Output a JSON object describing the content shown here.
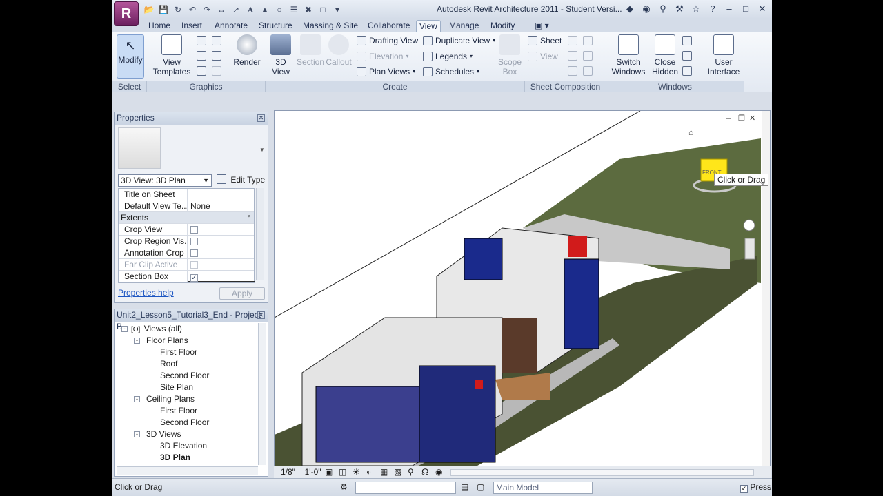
{
  "app": {
    "title": "Autodesk Revit Architecture 2011 - Student Versi...",
    "logo_letter": "R",
    "colors": {
      "app_purple": "#8e2f7c",
      "ribbon_bg": "#eef2f8",
      "grass": "#5c6b3f",
      "window_blue": "#1a2a8c",
      "accent_red": "#d11b1b"
    }
  },
  "tabs": [
    {
      "label": "Home"
    },
    {
      "label": "Insert"
    },
    {
      "label": "Annotate"
    },
    {
      "label": "Structure"
    },
    {
      "label": "Massing & Site"
    },
    {
      "label": "Collaborate"
    },
    {
      "label": "View"
    },
    {
      "label": "Manage"
    },
    {
      "label": "Modify"
    }
  ],
  "active_tab": "View",
  "ribbon": {
    "modify": "Modify",
    "view_templates": "View Templates",
    "render": "Render",
    "view_3d": "3D View",
    "section": "Section",
    "callout": "Callout",
    "drafting_view": "Drafting View",
    "elevation": "Elevation",
    "plan_views": "Plan Views",
    "duplicate_view": "Duplicate View",
    "legends": "Legends",
    "schedules": "Schedules",
    "scope_box": "Scope Box",
    "sheet": "Sheet",
    "view": "View",
    "switch_windows": "Switch Windows",
    "close_hidden": "Close Hidden",
    "user_interface": "User Interface",
    "panels": {
      "select": "Select",
      "graphics": "Graphics",
      "create": "Create",
      "sheet_composition": "Sheet Composition",
      "windows": "Windows"
    }
  },
  "properties": {
    "title": "Properties",
    "type_selector": "3D View: 3D Plan",
    "edit_type": "Edit Type",
    "rows": [
      {
        "key": "Title on Sheet",
        "value": ""
      },
      {
        "key": "Default View Te...",
        "value": "None"
      }
    ],
    "group": "Extents",
    "checks": [
      {
        "key": "Crop View",
        "checked": false
      },
      {
        "key": "Crop Region Vis...",
        "checked": false
      },
      {
        "key": "Annotation Crop",
        "checked": false
      },
      {
        "key": "Far Clip Active",
        "checked": false
      },
      {
        "key": "Section Box",
        "checked": true
      }
    ],
    "help": "Properties help",
    "apply": "Apply"
  },
  "browser": {
    "title": "Unit2_Lesson5_Tutorial3_End - Project B...",
    "nodes": [
      {
        "label": "Views (all)",
        "level": 0,
        "toggle": "-"
      },
      {
        "label": "Floor Plans",
        "level": 1,
        "toggle": "-"
      },
      {
        "label": "First Floor",
        "level": 2
      },
      {
        "label": "Roof",
        "level": 2
      },
      {
        "label": "Second Floor",
        "level": 2
      },
      {
        "label": "Site Plan",
        "level": 2
      },
      {
        "label": "Ceiling Plans",
        "level": 1,
        "toggle": "-"
      },
      {
        "label": "First Floor",
        "level": 2
      },
      {
        "label": "Second Floor",
        "level": 2
      },
      {
        "label": "3D Views",
        "level": 1,
        "toggle": "-"
      },
      {
        "label": "3D Elevation",
        "level": 2
      },
      {
        "label": "3D Plan",
        "level": 2,
        "selected": true
      }
    ]
  },
  "viewcube": {
    "face": "FRONT",
    "tooltip": "Click or Drag"
  },
  "view_control": {
    "scale": "1/8\" = 1'-0\""
  },
  "status": {
    "text": "Click or Drag",
    "model": "Main Model",
    "press": "Press"
  }
}
